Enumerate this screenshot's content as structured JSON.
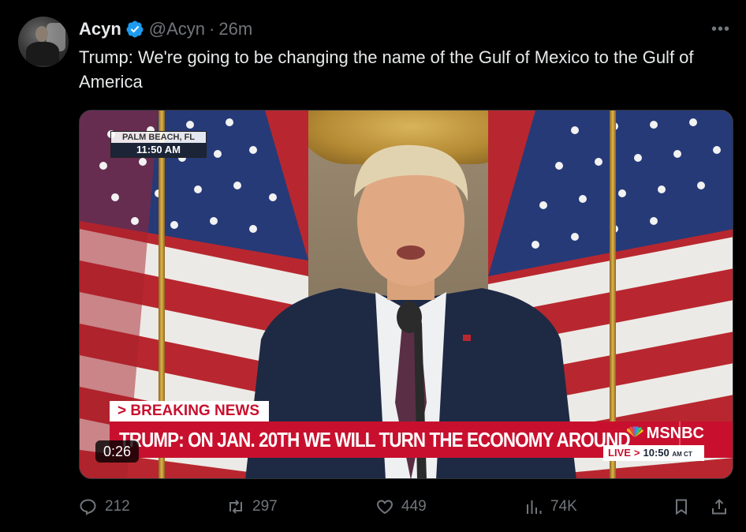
{
  "tweet": {
    "author_name": "Acyn",
    "handle": "@Acyn",
    "separator": "·",
    "time": "26m",
    "text": "Trump: We're going to be changing the name of the Gulf of Mexico to the Gulf of America",
    "more_icon": "more-horizontal-icon",
    "verified_icon": "verified-badge-icon"
  },
  "media": {
    "duration": "0:26",
    "location_bug": {
      "location": "PALM BEACH, FL",
      "time": "11:50 AM"
    },
    "lower_third": {
      "kicker": "> BREAKING NEWS",
      "headline": "TRUMP: ON JAN. 20TH WE WILL TURN THE ECONOMY AROUND",
      "network": "MSNBC",
      "live_label": "LIVE",
      "live_arrow": ">",
      "live_time": "10:50",
      "live_zone": "AM CT"
    }
  },
  "actions": {
    "replies": "212",
    "reposts": "297",
    "likes": "449",
    "views": "74K",
    "icons": [
      "reply-icon",
      "repost-icon",
      "like-icon",
      "views-icon",
      "bookmark-icon",
      "share-icon"
    ]
  },
  "colors": {
    "background": "#000000",
    "primary_text": "#e7e9ea",
    "secondary_text": "#71767b",
    "verified_blue": "#1d9bf0",
    "msnbc_red": "#c8102e"
  }
}
